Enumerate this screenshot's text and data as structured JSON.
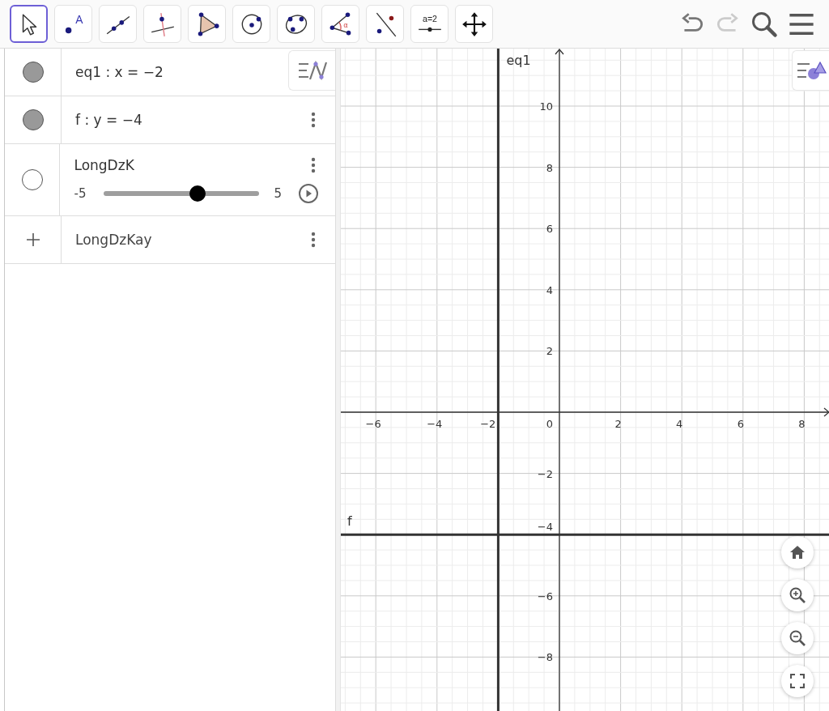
{
  "toolbar": {
    "tools": [
      {
        "kind": "move",
        "selected": true
      },
      {
        "kind": "point",
        "selected": false,
        "text": "A"
      },
      {
        "kind": "line",
        "selected": false
      },
      {
        "kind": "perpendicular",
        "selected": false
      },
      {
        "kind": "polygon",
        "selected": false
      },
      {
        "kind": "circle",
        "selected": false
      },
      {
        "kind": "conic",
        "selected": false
      },
      {
        "kind": "angle",
        "selected": false,
        "text": "α"
      },
      {
        "kind": "reflect",
        "selected": false
      },
      {
        "kind": "slider",
        "selected": false,
        "text": "a=2"
      },
      {
        "kind": "move-view",
        "selected": false
      }
    ],
    "undo": {
      "disabled": false
    },
    "redo": {
      "disabled": true
    }
  },
  "algebra": {
    "rows": [
      {
        "kind": "equation",
        "visible": true,
        "text": "eq1 : x = −2",
        "has_menu": false
      },
      {
        "kind": "equation",
        "visible": true,
        "text": "f : y = −4",
        "has_menu": true
      },
      {
        "kind": "slider",
        "visible": false,
        "text": "LongDzK",
        "min": "-5",
        "max": "5",
        "level": 0.6,
        "has_menu": true
      },
      {
        "kind": "input",
        "value": "LongDzKay",
        "has_menu": true
      }
    ]
  },
  "graph": {
    "x_ticks": [
      "−6",
      "−4",
      "2",
      "4",
      "6",
      "8"
    ],
    "y_ticks": [
      "10",
      "8",
      "6",
      "4",
      "2",
      "−2",
      "−6",
      "−8"
    ],
    "origin_label": "0",
    "lines": [
      {
        "label": "eq1",
        "kind": "vertical",
        "at": "−2"
      },
      {
        "label": "f",
        "kind": "horizontal",
        "at": "−4"
      }
    ]
  }
}
